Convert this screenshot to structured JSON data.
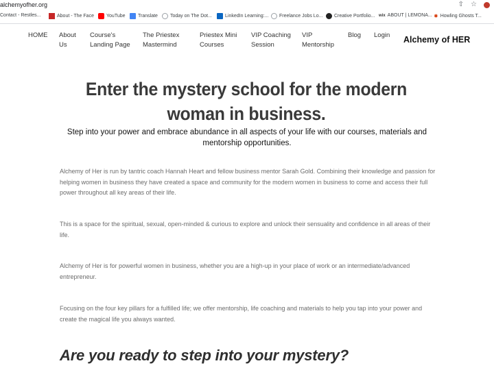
{
  "browser": {
    "url": "alchemyofher.org",
    "bookmarks": [
      {
        "label": "Contact - Restles...",
        "icon": "globe-icon",
        "color": "#9aa0a6"
      },
      {
        "label": "About - The Face",
        "icon": "red-square-icon",
        "color": "#c62828"
      },
      {
        "label": "YouTube",
        "icon": "youtube-icon",
        "color": "#ff0000"
      },
      {
        "label": "Translate",
        "icon": "translate-icon",
        "color": "#4285f4"
      },
      {
        "label": "Today on The Dot...",
        "icon": "globe-icon",
        "color": "#9aa0a6"
      },
      {
        "label": "LinkedIn Learning:...",
        "icon": "linkedin-icon",
        "color": "#0a66c2"
      },
      {
        "label": "Freelance Jobs Lo...",
        "icon": "globe-icon",
        "color": "#9aa0a6"
      },
      {
        "label": "Creative Portfolio...",
        "icon": "dark-circle-icon",
        "color": "#222222"
      },
      {
        "label": "ABOUT | LEMONA...",
        "icon": "wix-icon",
        "color": "#333333"
      },
      {
        "label": "Howling Ghosts T...",
        "icon": "ghost-icon",
        "color": "#d84315"
      }
    ]
  },
  "nav": {
    "items": [
      "HOME",
      "About Us",
      "Course's Landing Page",
      "The Priestex Mastermind",
      "Priestex Mini Courses",
      "VIP Coaching Session",
      "VIP Mentorship",
      "Blog",
      "Login"
    ],
    "brand": "Alchemy of HER"
  },
  "hero": {
    "title": "Enter the mystery school for the modern woman in business.",
    "subtitle": "Step into your power and embrace abundance in all aspects of your life with our courses, materials and mentorship opportunities."
  },
  "paragraphs": [
    "Alchemy of Her is run by tantric coach Hannah Heart and fellow business mentor Sarah Gold. Combining their knowledge and passion for helping women in business they have created a space and community for the modern women in business to come and access their full power throughout all key areas of their life.",
    "This is a space for the spiritual, sexual, open-minded & curious to explore and unlock their sensuality and confidence in all areas of their life.",
    "Alchemy of Her is for powerful women in business, whether you are a high-up in your place of work or an intermediate/advanced entrepreneur.",
    "Focusing on the four key pillars for a fulfilled life; we offer mentorship, life coaching and materials to help you tap into your power and create the magical life you always wanted."
  ],
  "cta_heading": "Are you ready to step into your mystery?"
}
